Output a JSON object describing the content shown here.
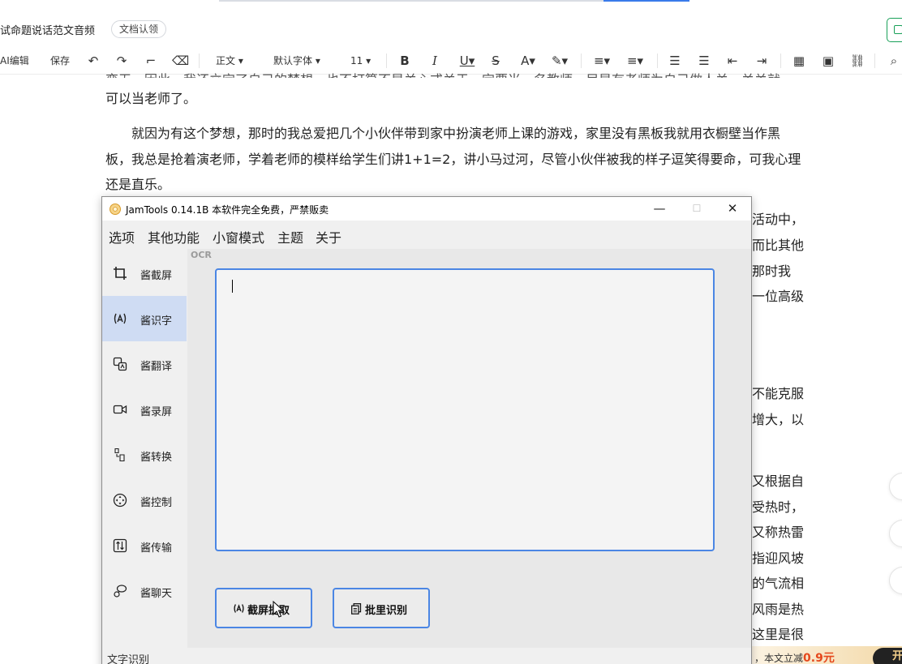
{
  "editor": {
    "doc_title": "试命题说话范文音频",
    "claim_button": "文档认领",
    "toolbar": {
      "ai_edit": "AI编辑",
      "save": "保存",
      "style": "正文",
      "font": "默认字体",
      "size": "11"
    },
    "body_lines": [
      "可以当老师了。",
      "就因为有这个梦想，那时的我总爱把几个小伙伴带到家中扮演老师上课的游戏，家里没有黑板我就用衣橱壁当作黑",
      "板，我总是抢着演老师，学着老师的模样给学生们讲1+1=2，讲小马过河，尽管小伙伴被我的样子逗笑得要命，可我心理",
      "还是直乐。"
    ],
    "partial_line": "变无。因此，我还立定了自己的梦想。也不打算不是关心或关于一定要当一名教师，尼是有老师为自己做人关，关关就",
    "right_fragments": [
      "活动中，",
      "而比其他",
      "那时我",
      "一位高级",
      "不能克服",
      "增大，以",
      "又根据自",
      "受热时，",
      "又称热雷",
      "指迎风坡",
      "的气流相",
      "风雨是热",
      "这里是很"
    ],
    "promo": {
      "text": "，本文立减",
      "price": "0.9元",
      "open_button": "开"
    }
  },
  "jamtools": {
    "title": "JamTools 0.14.1B 本软件完全免费，严禁贩卖",
    "window_controls": {
      "minimize": "—",
      "maximize": "☐",
      "close": "✕"
    },
    "menu": [
      "选项",
      "其他功能",
      "小窗模式",
      "主题",
      "关于"
    ],
    "sidebar": [
      {
        "label": "酱截屏",
        "icon": "crop-icon",
        "active": false
      },
      {
        "label": "酱识字",
        "icon": "ocr-icon",
        "active": true
      },
      {
        "label": "酱翻译",
        "icon": "translate-icon",
        "active": false
      },
      {
        "label": "酱录屏",
        "icon": "video-icon",
        "active": false
      },
      {
        "label": "酱转换",
        "icon": "convert-icon",
        "active": false
      },
      {
        "label": "酱控制",
        "icon": "control-icon",
        "active": false
      },
      {
        "label": "酱传输",
        "icon": "transfer-icon",
        "active": false
      },
      {
        "label": "酱聊天",
        "icon": "chat-icon",
        "active": false
      }
    ],
    "ocr": {
      "section_label": "OCR",
      "text_value": "",
      "screenshot_button": "截屏提取",
      "batch_button": "批里识别"
    },
    "status": "文字识别",
    "accent_color": "#4b86e4",
    "active_nav_color": "#cfdcf3"
  }
}
